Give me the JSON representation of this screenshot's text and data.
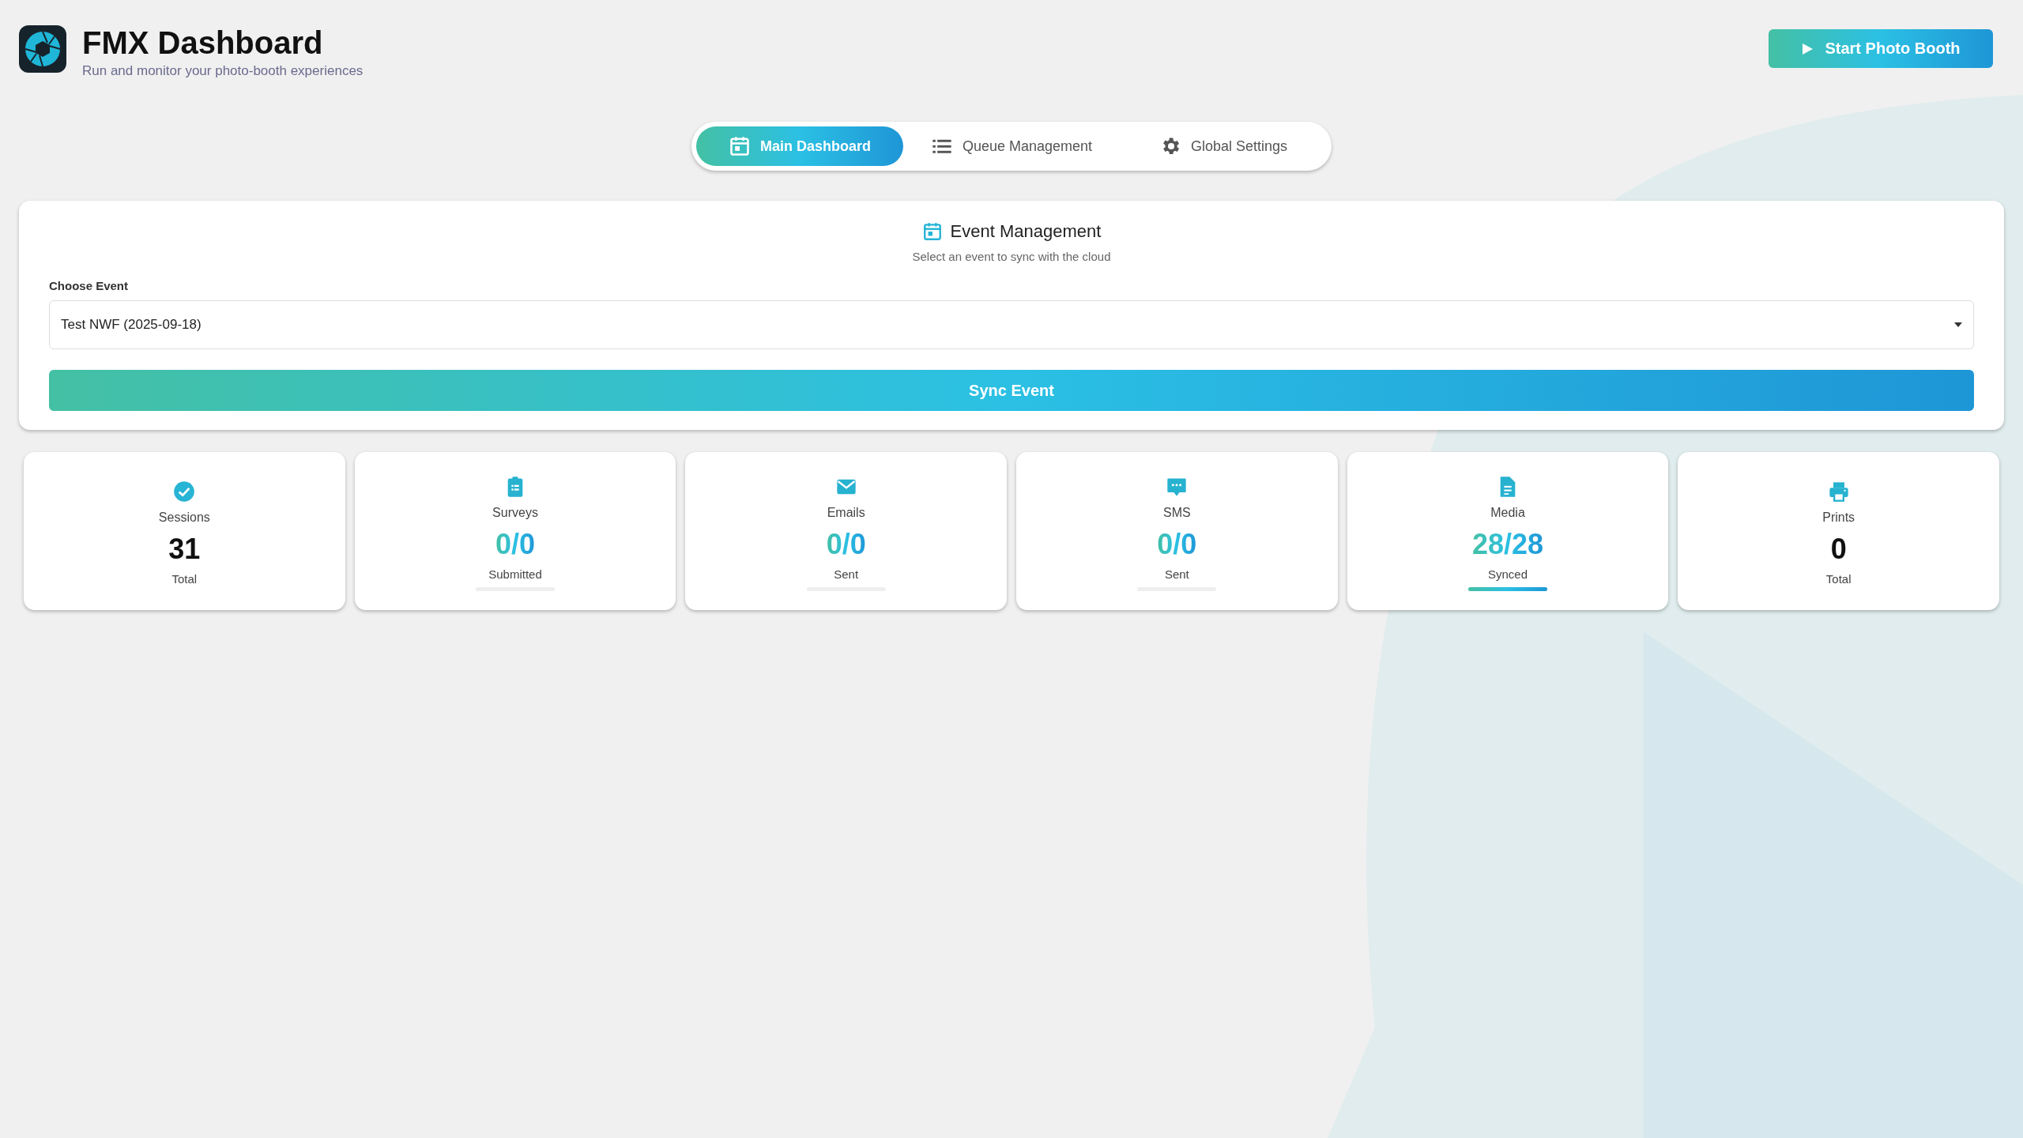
{
  "header": {
    "title": "FMX Dashboard",
    "subtitle": "Run and monitor your photo-booth experiences",
    "start_button": "Start Photo Booth"
  },
  "tabs": [
    {
      "label": "Main Dashboard",
      "selected": true
    },
    {
      "label": "Queue Management",
      "selected": false
    },
    {
      "label": "Global Settings",
      "selected": false
    }
  ],
  "event_card": {
    "title": "Event Management",
    "subtitle": "Select an event to sync with the cloud",
    "field_label": "Choose Event",
    "value": "Test NWF (2025-09-18)",
    "sync_button": "Sync Event"
  },
  "stats": [
    {
      "kind": "total",
      "label": "Sessions",
      "value": "31",
      "caption": "Total"
    },
    {
      "kind": "ratio",
      "label": "Surveys",
      "value": "0/0",
      "caption": "Submitted",
      "level": 0
    },
    {
      "kind": "ratio",
      "label": "Emails",
      "value": "0/0",
      "caption": "Sent",
      "level": 0
    },
    {
      "kind": "ratio",
      "label": "SMS",
      "value": "0/0",
      "caption": "Sent",
      "level": 0
    },
    {
      "kind": "ratio",
      "label": "Media",
      "value": "28/28",
      "caption": "Synced",
      "level": 1
    },
    {
      "kind": "total",
      "label": "Prints",
      "value": "0",
      "caption": "Total"
    }
  ]
}
